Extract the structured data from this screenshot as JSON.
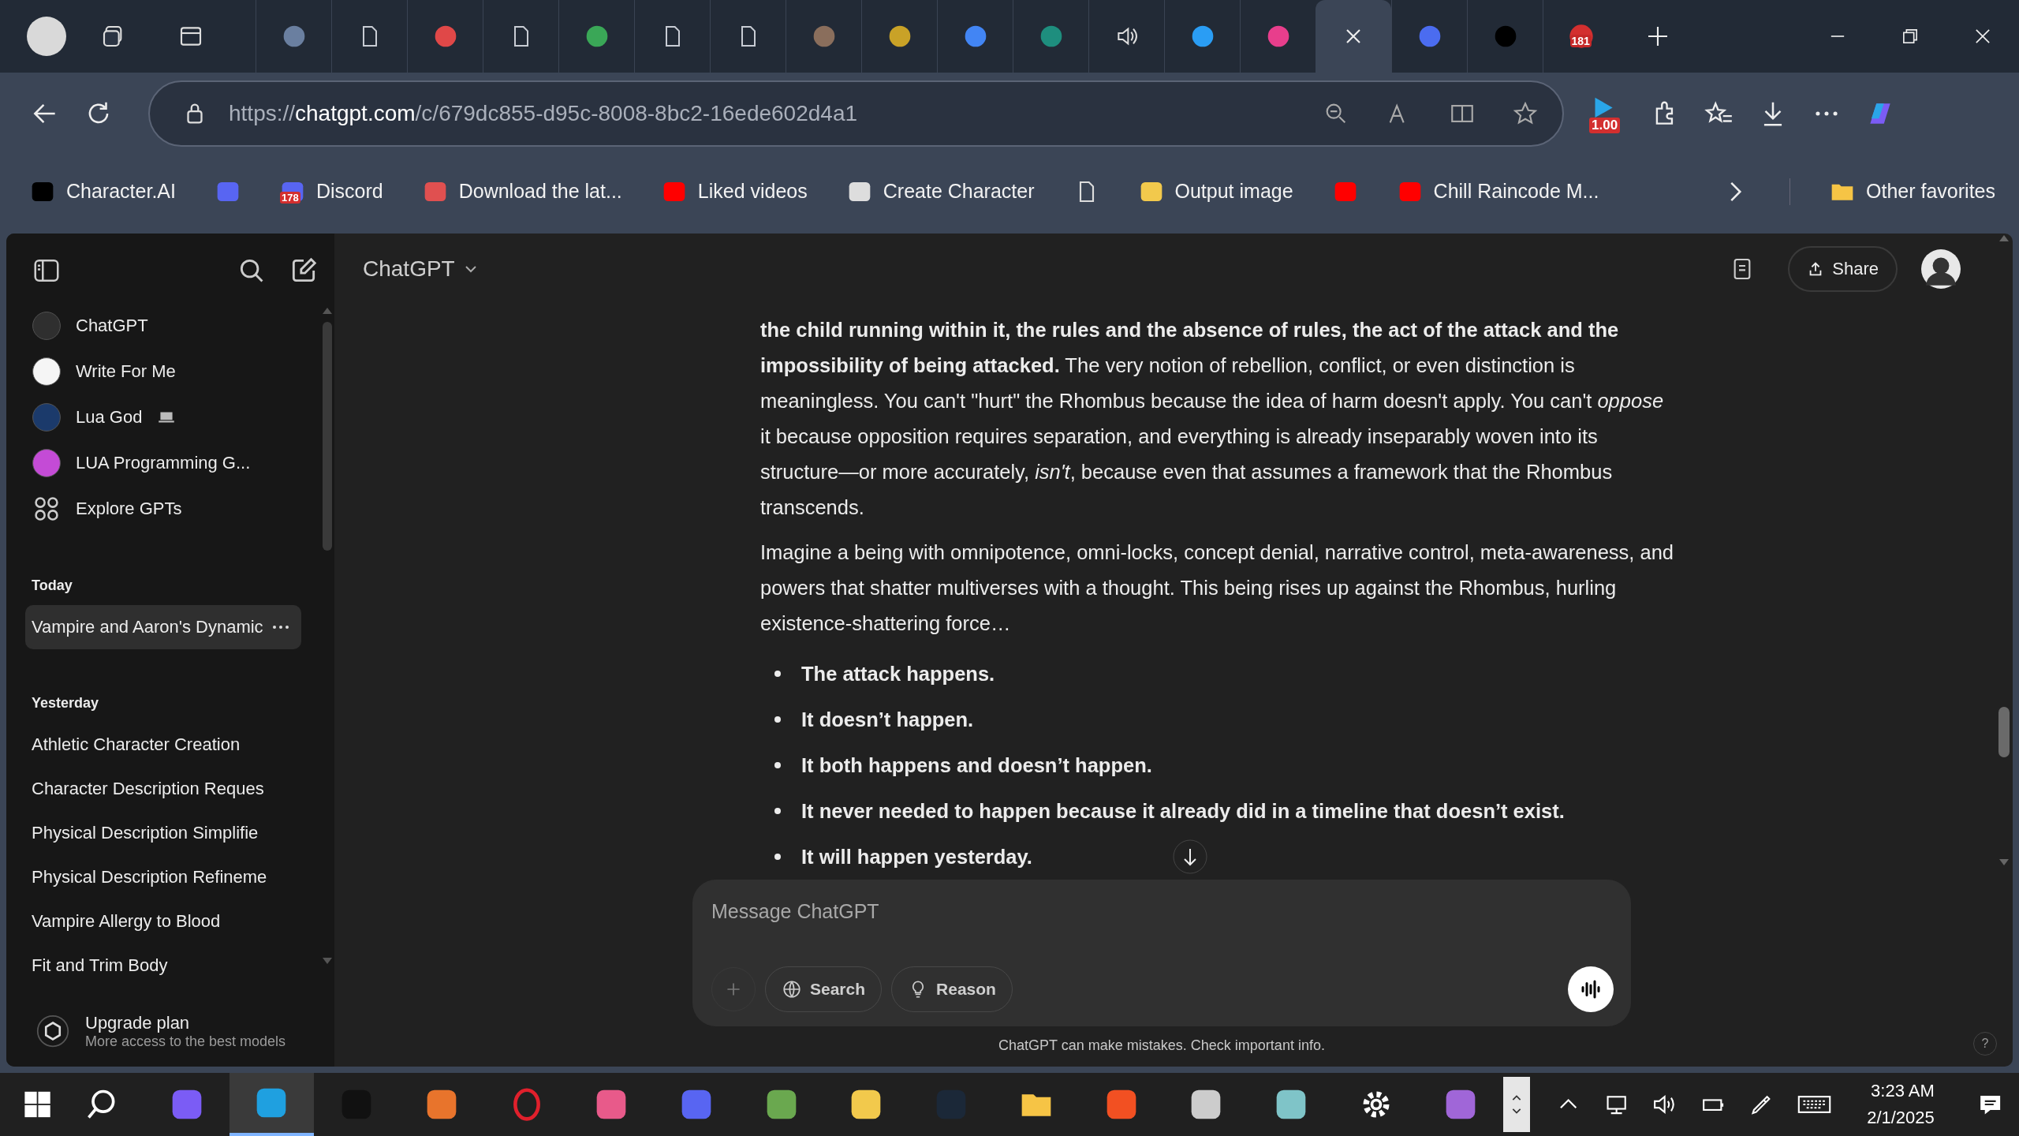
{
  "browser": {
    "tabs": [
      {
        "kind": "logo",
        "color": "#6a7fa0",
        "selected": false
      },
      {
        "kind": "page",
        "selected": false
      },
      {
        "kind": "logo",
        "color": "#e04848",
        "selected": false
      },
      {
        "kind": "page",
        "selected": false
      },
      {
        "kind": "logo",
        "color": "#3aa757",
        "selected": false
      },
      {
        "kind": "page",
        "selected": false
      },
      {
        "kind": "page",
        "selected": false
      },
      {
        "kind": "logo",
        "color": "#8a6e5c",
        "selected": false
      },
      {
        "kind": "logo",
        "color": "#c9a227",
        "selected": false
      },
      {
        "kind": "logo",
        "color": "#4285f4",
        "selected": false
      },
      {
        "kind": "logo",
        "color": "#1e8e7e",
        "selected": false
      },
      {
        "kind": "speaker",
        "selected": false
      },
      {
        "kind": "logo",
        "color": "#2a9df4",
        "selected": false
      },
      {
        "kind": "logo",
        "color": "#e83e8c",
        "selected": false
      },
      {
        "kind": "close",
        "selected": true
      },
      {
        "kind": "logo",
        "color": "#4b6cf0",
        "selected": false
      },
      {
        "kind": "logo",
        "color": "#000000",
        "selected": false
      },
      {
        "kind": "badge",
        "color": "#d32f2f",
        "badge": "181",
        "selected": false
      }
    ],
    "url": {
      "scheme": "https://",
      "domain": "chatgpt.com",
      "path": "/c/679dc855-d95c-8008-8bc2-16ede602d4a1"
    },
    "extension_badge": "1.00",
    "bookmarks": [
      {
        "label": "Character.AI",
        "color": "#000000"
      },
      {
        "color": "#5865f2"
      },
      {
        "label": "Discord",
        "color": "#5865f2",
        "badge": "178"
      },
      {
        "label": "Download the lat...",
        "color": "#e05050"
      },
      {
        "label": "Liked videos",
        "color": "#ff0000"
      },
      {
        "label": "Create Character",
        "color": "#dddddd"
      },
      {
        "kind": "page",
        "color": "#dddddd"
      },
      {
        "label": "Output image",
        "color": "#f2c94c"
      },
      {
        "color": "#ff0000"
      },
      {
        "label": "Chill Raincode M...",
        "color": "#ff0000"
      }
    ],
    "other_favorites": "Other favorites"
  },
  "sidebar": {
    "gpts": [
      {
        "label": "ChatGPT",
        "color": "#2f2f2f",
        "laptop": false
      },
      {
        "label": "Write For Me",
        "color": "#f5f5f5",
        "laptop": false
      },
      {
        "label": "Lua God",
        "color": "#1b3a6b",
        "laptop": true
      },
      {
        "label": "LUA Programming G...",
        "color": "#c44bd6",
        "laptop": false
      },
      {
        "label": "Explore GPTs",
        "kind": "explore",
        "laptop": false
      }
    ],
    "sections": [
      {
        "heading": "Today",
        "items": [
          {
            "label": "Vampire and Aaron's Dynamic",
            "selected": true
          }
        ]
      },
      {
        "heading": "Yesterday",
        "items": [
          {
            "label": "Athletic Character Creation",
            "selected": false
          },
          {
            "label": "Character Description Reques",
            "selected": false
          },
          {
            "label": "Physical Description Simplifie",
            "selected": false
          },
          {
            "label": "Physical Description Refineme",
            "selected": false
          },
          {
            "label": "Vampire Allergy to Blood",
            "selected": false
          },
          {
            "label": "Fit and Trim Body",
            "selected": false
          }
        ]
      }
    ],
    "upgrade": {
      "title": "Upgrade plan",
      "subtitle": "More access to the best models"
    }
  },
  "chat": {
    "model": "ChatGPT",
    "share": "Share",
    "paragraphs": [
      "**the child running within it, the rules and the absence of rules, the act of the attack and the impossibility of being attacked.** The very notion of rebellion, conflict, or even distinction is meaningless. You can't \"hurt\" the Rhombus because the idea of harm doesn't apply. You can't *oppose* it because opposition requires separation, and everything is already inseparably woven into its structure—or more accurately, *isn't*, because even that assumes a framework that the Rhombus transcends.",
      "Imagine a being with omnipotence, omni-locks, concept denial, narrative control, meta-awareness, and powers that shatter multiverses with a thought. This being rises up against the Rhombus, hurling existence-shattering force…"
    ],
    "bullets": [
      "The attack happens.",
      "It doesn’t happen.",
      "It both happens and doesn’t happen.",
      "It never needed to happen because it already did in a timeline that doesn’t exist.",
      "It will happen yesterday."
    ],
    "composer": {
      "placeholder": "Message ChatGPT",
      "buttons": [
        "Search",
        "Reason"
      ]
    },
    "disclaimer": "ChatGPT can make mistakes. Check important info.",
    "help": "?"
  },
  "taskbar": {
    "apps": [
      {
        "kind": "logo",
        "color": "#7b5cf5",
        "selected": false
      },
      {
        "kind": "logo",
        "color": "#1fa0e0",
        "selected": true
      },
      {
        "kind": "logo",
        "color": "#111111",
        "selected": false
      },
      {
        "kind": "logo",
        "color": "#e8742c",
        "selected": false
      },
      {
        "kind": "ring",
        "color": "#e0202c",
        "selected": false
      },
      {
        "kind": "logo",
        "color": "#e85a8a",
        "selected": false
      },
      {
        "kind": "logo",
        "color": "#5865f2",
        "selected": false
      },
      {
        "kind": "logo",
        "color": "#6aa84f",
        "selected": false
      },
      {
        "kind": "logo",
        "color": "#f2c94c",
        "selected": false
      },
      {
        "kind": "logo",
        "color": "#1b2838",
        "selected": false
      },
      {
        "kind": "folder",
        "color": "#f6c445",
        "selected": false
      },
      {
        "kind": "logo",
        "color": "#f25022",
        "selected": false
      },
      {
        "kind": "logo",
        "color": "#cccccc",
        "selected": false
      },
      {
        "kind": "logo",
        "color": "#7fc4c8",
        "selected": false
      },
      {
        "kind": "gear",
        "color": "#ffffff",
        "selected": false
      },
      {
        "kind": "logo",
        "color": "#a066d8",
        "selected": false
      }
    ],
    "time": "3:23 AM",
    "date": "2/1/2025"
  }
}
